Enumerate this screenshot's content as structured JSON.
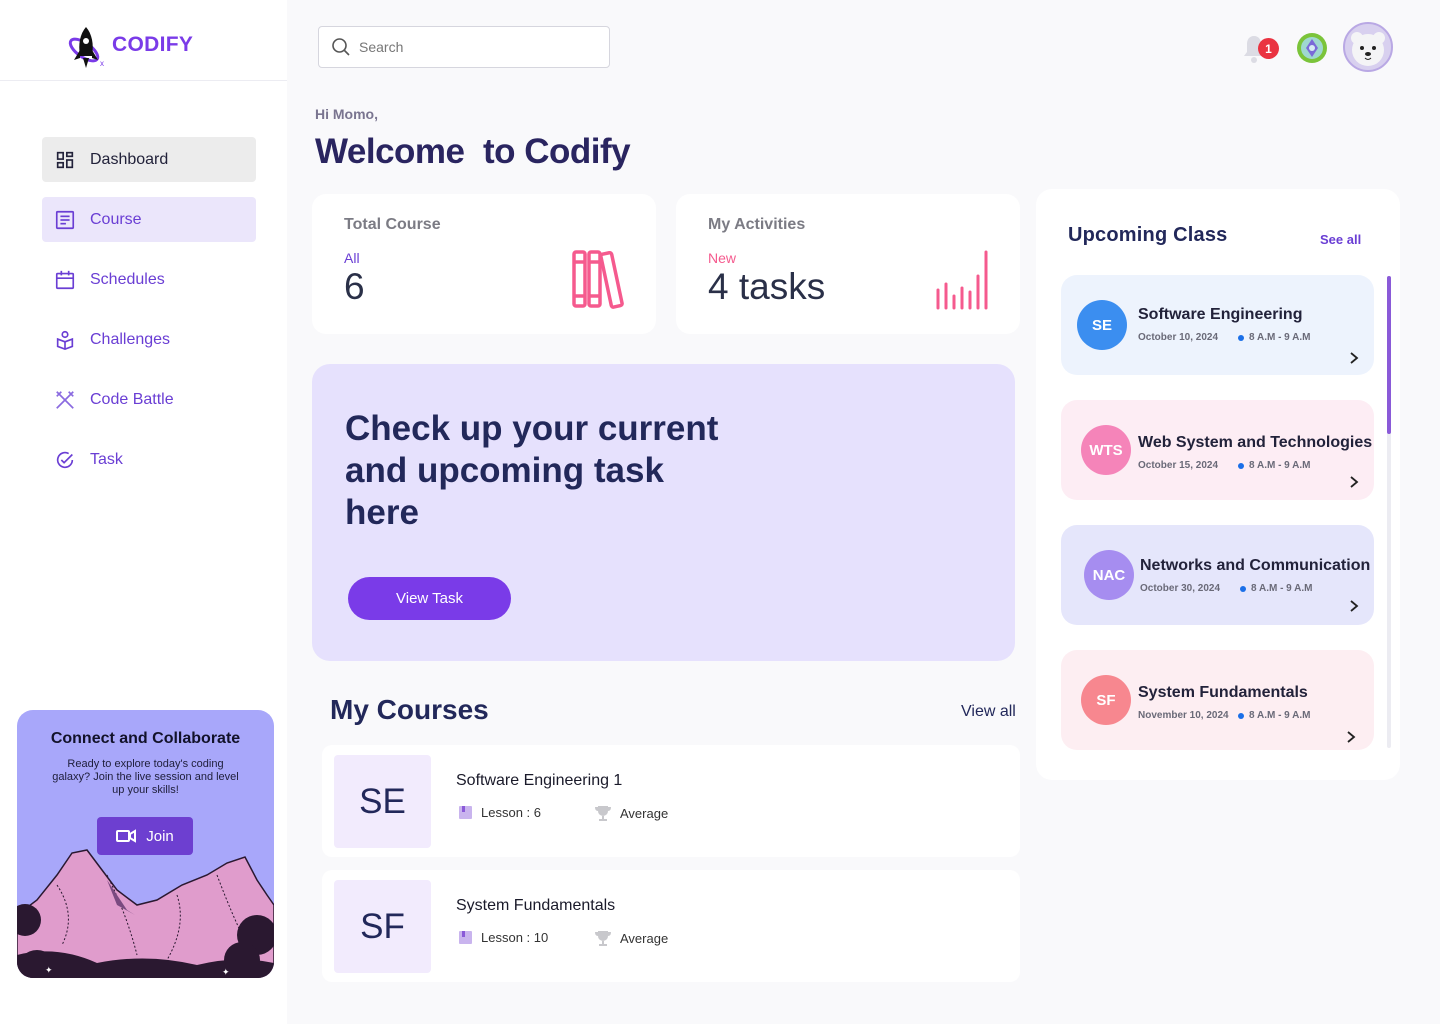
{
  "brand": {
    "name": "CODIFY"
  },
  "sidebar": {
    "items": [
      {
        "label": "Dashboard",
        "icon": "dashboard-icon"
      },
      {
        "label": "Course",
        "icon": "course-icon"
      },
      {
        "label": "Schedules",
        "icon": "calendar-icon"
      },
      {
        "label": "Challenges",
        "icon": "challenges-icon"
      },
      {
        "label": "Code Battle",
        "icon": "swords-icon"
      },
      {
        "label": "Task",
        "icon": "check-circle-icon"
      }
    ],
    "promo": {
      "title": "Connect and Collaborate",
      "text": "Ready to explore today's coding galaxy? Join the live session and level up your skills!",
      "button": "Join"
    }
  },
  "header": {
    "search_placeholder": "Search",
    "notification_count": "1"
  },
  "main": {
    "greeting": "Hi Momo,",
    "welcome": "Welcome  to Codify",
    "stats": {
      "total": {
        "title": "Total Course",
        "sub": "All",
        "value": "6"
      },
      "activities": {
        "title": "My Activities",
        "sub": "New",
        "value": "4 tasks"
      }
    },
    "hero": {
      "text": "Check up your current and upcoming task here",
      "button": "View Task"
    },
    "courses": {
      "title": "My Courses",
      "view_all": "View all",
      "items": [
        {
          "abbr": "SE",
          "name": "Software Engineering 1",
          "lessons": "Lesson : 6",
          "level": "Average"
        },
        {
          "abbr": "SF",
          "name": "System Fundamentals",
          "lessons": "Lesson : 10",
          "level": "Average"
        }
      ]
    }
  },
  "upcoming": {
    "title": "Upcoming Class",
    "see_all": "See all",
    "classes": [
      {
        "abbr": "SE",
        "name": "Software Engineering",
        "date": "October 10, 2024",
        "time": "8 A.M - 9 A.M",
        "bg": "#edf3fd",
        "color": "#3b8ef0"
      },
      {
        "abbr": "WTS",
        "name": "Web System and Technologies",
        "date": "October 15, 2024",
        "time": "8 A.M - 9 A.M",
        "bg": "#fdedf4",
        "color": "#f584b9"
      },
      {
        "abbr": "NAC",
        "name": "Networks and Communication",
        "date": "October 30, 2024",
        "time": "8 A.M - 9 A.M",
        "bg": "#e5e6fb",
        "color": "#a68df0"
      },
      {
        "abbr": "SF",
        "name": "System Fundamentals",
        "date": "November 10, 2024",
        "time": "8 A.M - 9 A.M",
        "bg": "#fdeef2",
        "color": "#f7878f"
      }
    ]
  },
  "colors": {
    "accent": "#7a3be8",
    "heading": "#22285a",
    "pink": "#f55a8e"
  }
}
